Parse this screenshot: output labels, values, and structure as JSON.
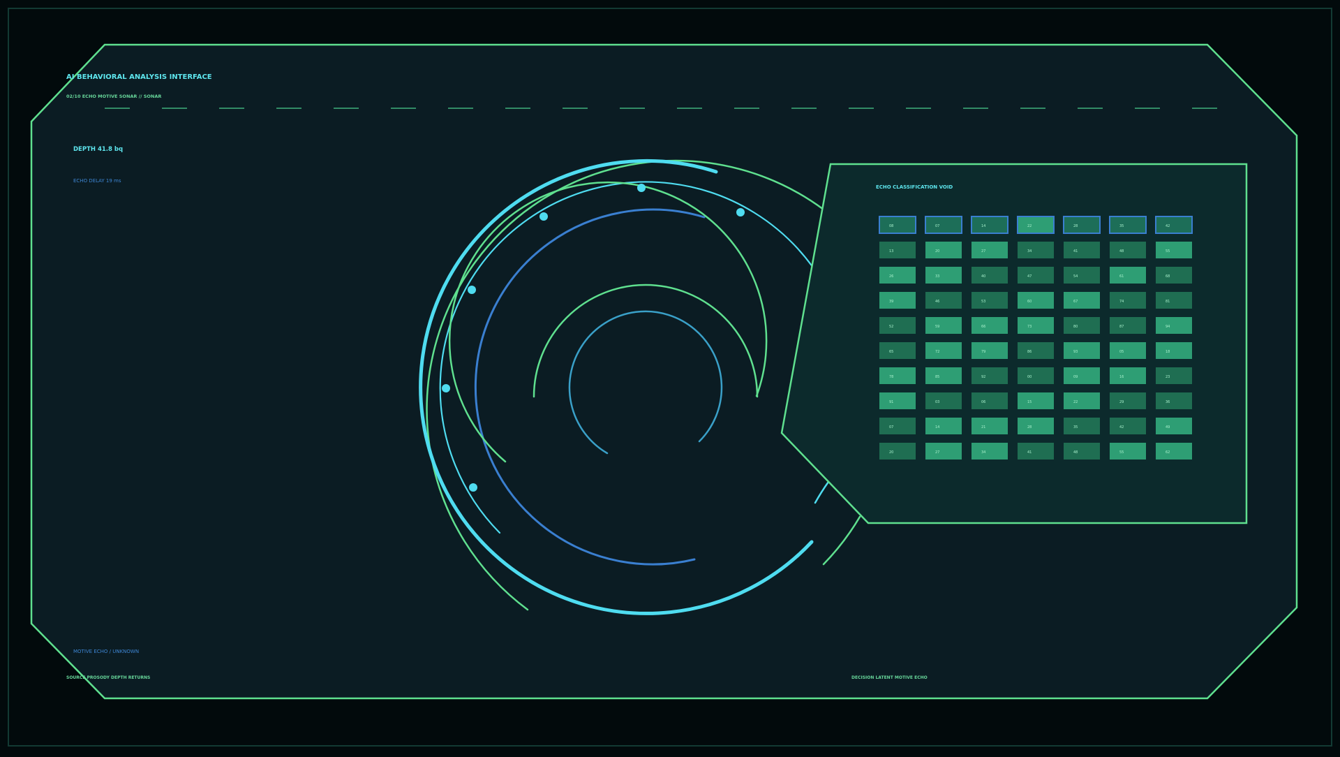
{
  "colors": {
    "page_bg": "#020a0c",
    "panel_bg": "#0b1c23",
    "panel_border": "#5fe08f",
    "outer_border": "#123a33",
    "classification_bg": "#0c2a2c",
    "accent_cyan": "#4fdcf0",
    "accent_blue": "#3a7fd0",
    "text_cyan": "#5ee6ee",
    "text_green": "#67d69a",
    "text_blue": "#3e86d4",
    "cell_light": "#2e9e74",
    "cell_dark": "#1f6e52",
    "cell_top_bg": "#1d6e58",
    "cell_top_border": "#3a7fd0"
  },
  "header": {
    "title": "AI BEHAVIORAL ANALYSIS INTERFACE",
    "subtitle": "02/10  ECHO MOTIVE SONAR  // SONAR"
  },
  "readouts": {
    "depth": "DEPTH 41.8 bq",
    "echo_delay": "ECHO DELAY 19 ms"
  },
  "footer": {
    "motive_echo": "MOTIVE ECHO / UNKNOWN",
    "source": "SOURCE PROSODY DEPTH RETURNS",
    "decision": "DECISION  LATENT MOTIVE ECHO"
  },
  "classification": {
    "title": "ECHO CLASSIFICATION VOID",
    "header_row": [
      "08",
      "07",
      "14",
      "22",
      "28",
      "35",
      "42"
    ],
    "rows": [
      [
        "13",
        "20",
        "27",
        "34",
        "41",
        "48",
        "55"
      ],
      [
        "26",
        "33",
        "40",
        "47",
        "54",
        "61",
        "68"
      ],
      [
        "39",
        "46",
        "53",
        "60",
        "67",
        "74",
        "81"
      ],
      [
        "52",
        "59",
        "66",
        "73",
        "80",
        "87",
        "94"
      ],
      [
        "65",
        "72",
        "79",
        "86",
        "93",
        "05",
        "18"
      ],
      [
        "78",
        "85",
        "92",
        "00",
        "09",
        "16",
        "23"
      ],
      [
        "91",
        "03",
        "06",
        "15",
        "22",
        "29",
        "36"
      ],
      [
        "07",
        "14",
        "21",
        "28",
        "35",
        "42",
        "49"
      ],
      [
        "20",
        "27",
        "34",
        "41",
        "48",
        "55",
        "62"
      ]
    ],
    "row_shades": [
      [
        "dark",
        "light",
        "light",
        "dark",
        "dark",
        "dark",
        "light"
      ],
      [
        "light",
        "light",
        "dark",
        "dark",
        "dark",
        "light",
        "dark"
      ],
      [
        "light",
        "dark",
        "dark",
        "light",
        "light",
        "dark",
        "dark"
      ],
      [
        "dark",
        "light",
        "light",
        "light",
        "dark",
        "dark",
        "light"
      ],
      [
        "dark",
        "light",
        "light",
        "dark",
        "light",
        "light",
        "light"
      ],
      [
        "light",
        "light",
        "dark",
        "dark",
        "light",
        "light",
        "dark"
      ],
      [
        "light",
        "dark",
        "dark",
        "light",
        "light",
        "dark",
        "dark"
      ],
      [
        "dark",
        "light",
        "light",
        "light",
        "dark",
        "dark",
        "light"
      ],
      [
        "dark",
        "light",
        "light",
        "dark",
        "dark",
        "light",
        "light"
      ]
    ],
    "header_shades": [
      "dark",
      "dark",
      "dark",
      "light",
      "dark",
      "dark",
      "dark"
    ]
  },
  "sonar": {
    "icon": "sonar-rings-icon",
    "node_count": 9
  }
}
